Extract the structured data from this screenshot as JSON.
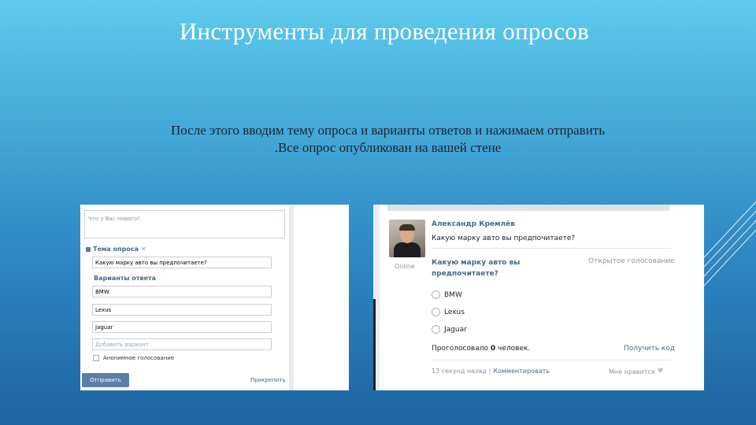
{
  "slide": {
    "title": "Инструменты для проведения опросов",
    "body_line1": "После этого вводим тему опроса и варианты ответов и нажимаем отправить",
    "body_line2": ".Все опрос опубликован на вашей стене"
  },
  "composer": {
    "placeholder": "Что у Вас нового?",
    "poll_topic_label": "Тема опроса",
    "poll_topic_value": "Какую марку авто вы предпочитаете?",
    "answers_label": "Варианты ответа",
    "answers": [
      "BMW",
      "Lexus",
      "Jaguar"
    ],
    "add_answer_placeholder": "Добавить вариант",
    "anonymous_label": "Анонимное голосование",
    "send_label": "Отправить",
    "attach_label": "Прикрепить"
  },
  "post": {
    "author": "Александр Кремлёв",
    "status": "Online",
    "text": "Какую марку авто вы предпочитаете?",
    "poll_question_line1": "Какую марку авто вы",
    "poll_question_line2": "предпочитаете?",
    "poll_type": "Открытое голосование",
    "options": [
      "BMW",
      "Lexus",
      "Jaguar"
    ],
    "voted_prefix": "Проголосовало",
    "voted_count": "0",
    "voted_suffix": "человек.",
    "get_code_label": "Получить код",
    "time": "13 секунд назад",
    "separator": "|",
    "comment_label": "Комментировать",
    "like_label": "Мне нравится"
  },
  "colors": {
    "link": "#45688e",
    "button": "#5b7fa6",
    "background_top": "#5ecbec",
    "background_bottom": "#1e64a3"
  },
  "icons": {
    "poll_icon": "poll-icon",
    "remove_icon": "remove-icon",
    "heart_icon": "heart-icon"
  }
}
